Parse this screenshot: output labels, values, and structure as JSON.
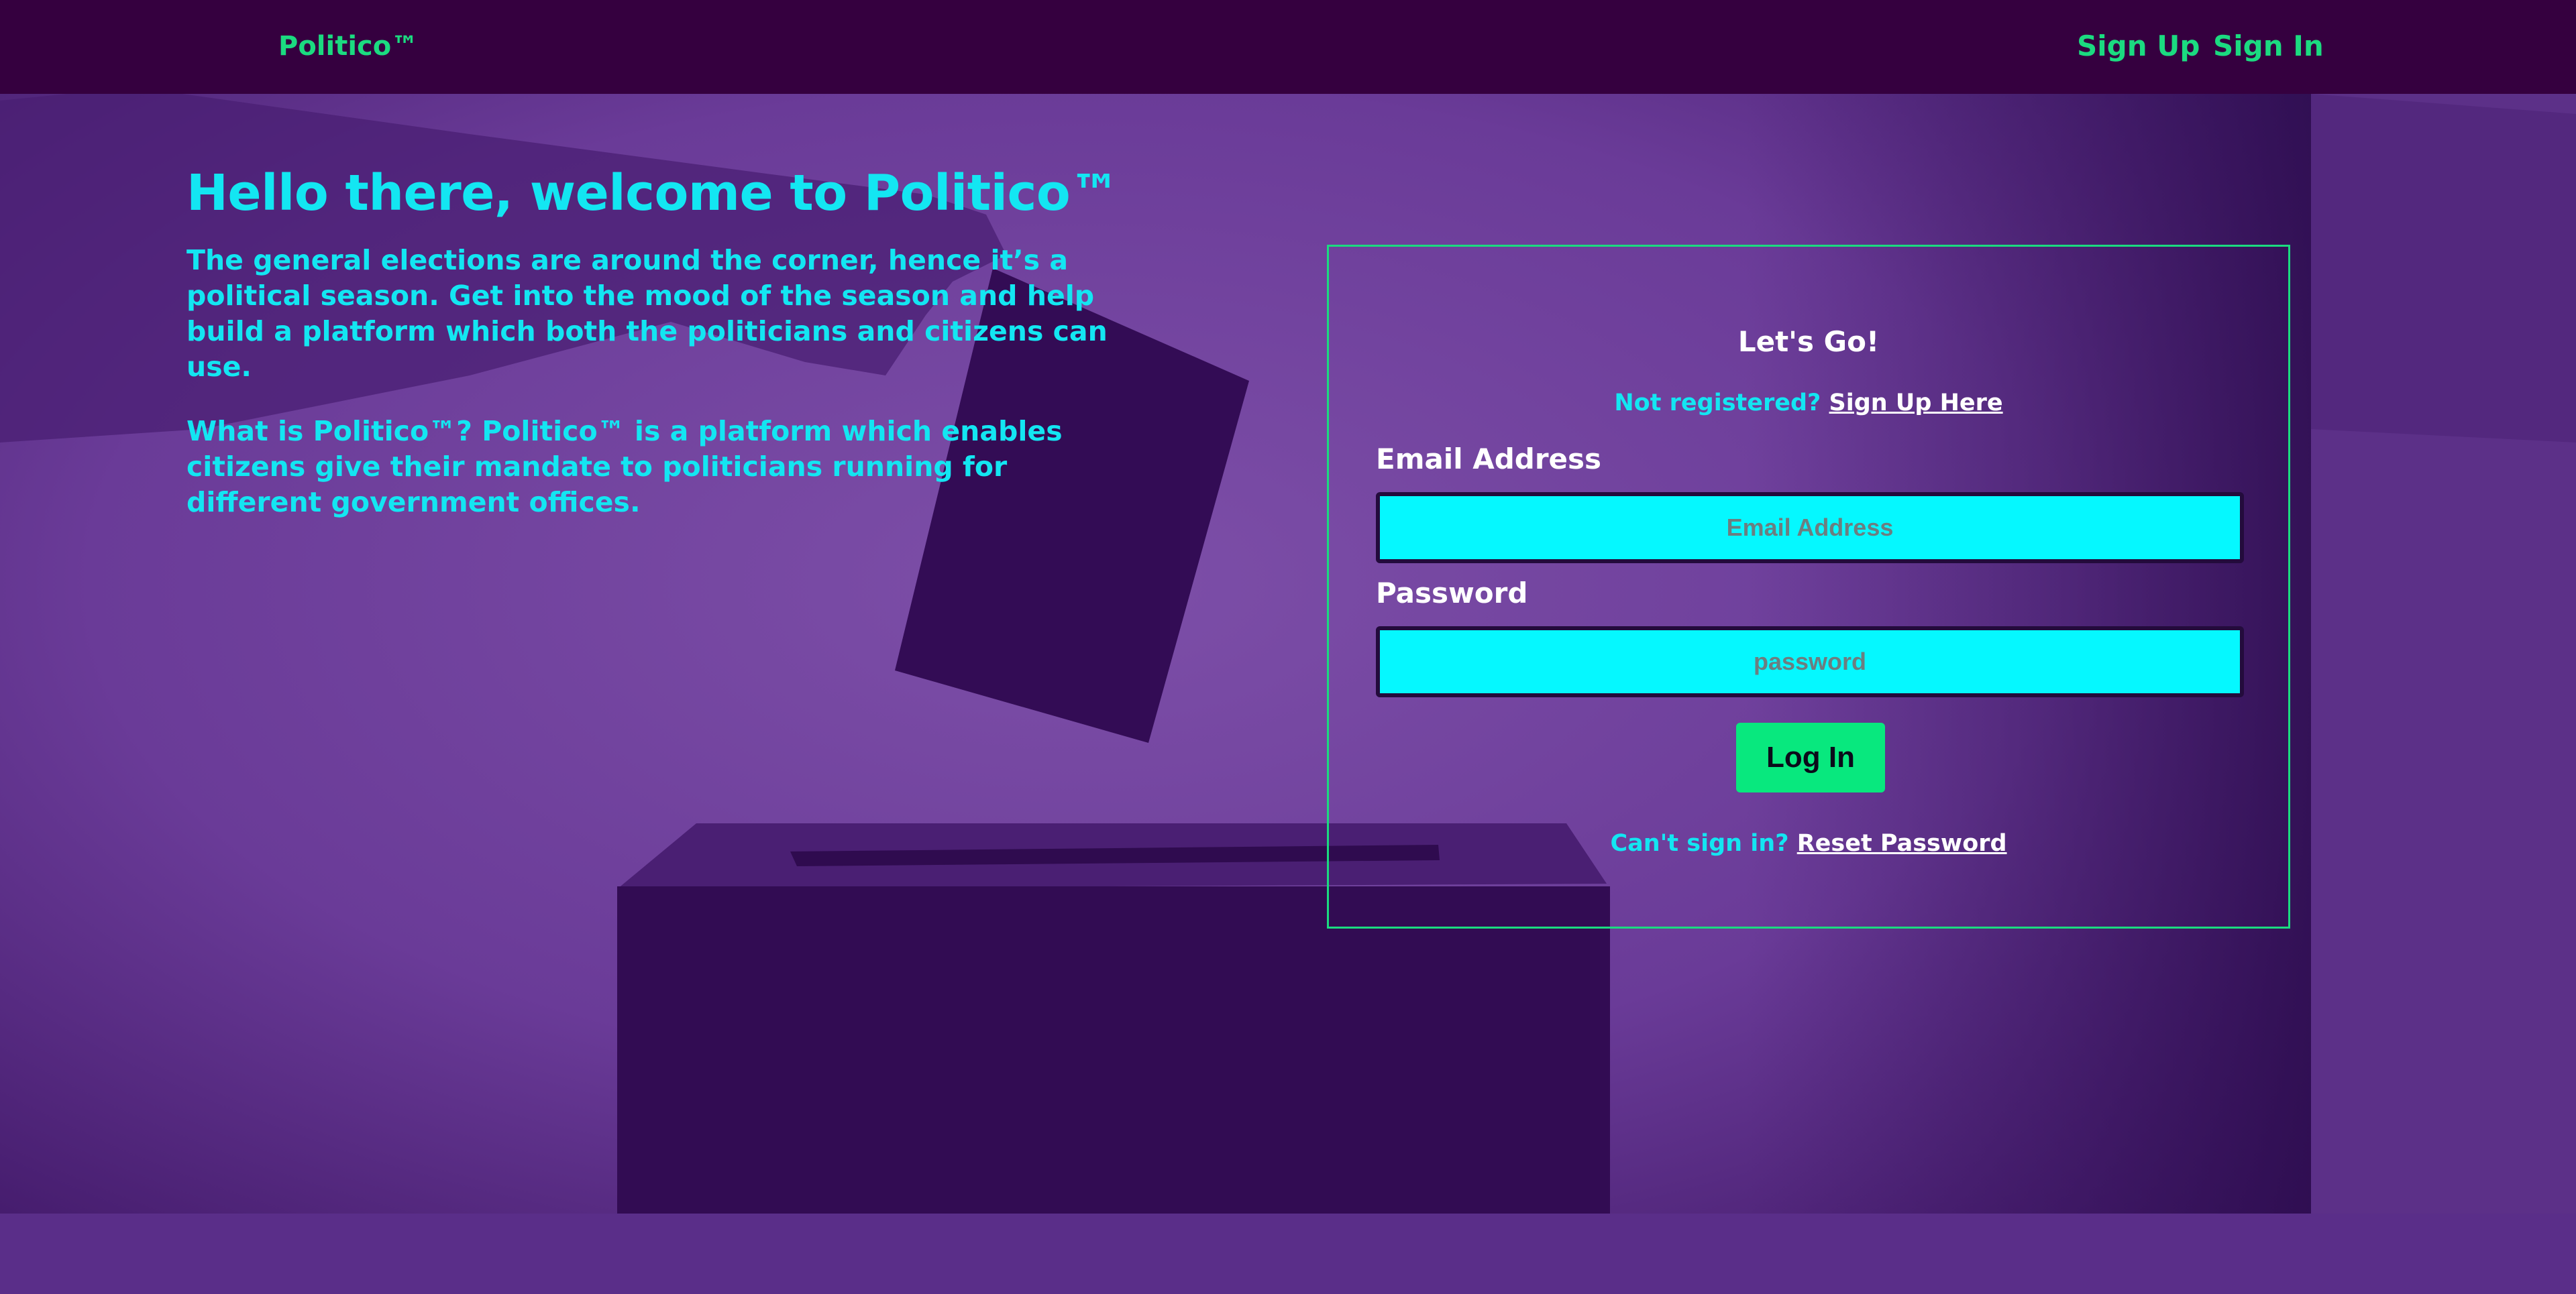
{
  "navbar": {
    "brand": "Politico™",
    "links": [
      {
        "label": "Sign Up"
      },
      {
        "label": "Sign In"
      }
    ]
  },
  "hero": {
    "heading": "Hello there, welcome to Politico™",
    "paragraph_1": "The general elections are around the corner, hence it’s a political season. Get into the mood of the season and help build a platform which both the politicians and citizens can use.",
    "paragraph_2": "What is Politico™? Politico™ is a platform which enables citizens give their mandate to politicians running for different government offices."
  },
  "login": {
    "title": "Let's Go!",
    "register_prompt": "Not registered?",
    "register_link": "Sign Up Here",
    "email_label": "Email Address",
    "email_placeholder": "Email Address",
    "email_value": "",
    "password_label": "Password",
    "password_placeholder": "password",
    "password_value": "",
    "submit_label": "Log In",
    "reset_prompt": "Can't sign in?",
    "reset_link": "Reset Password"
  },
  "colors": {
    "navbar_bg": "#35003f",
    "accent_green": "#1bdb80",
    "accent_cyan": "#13e6f2",
    "input_bg": "#05f8ff",
    "button_bg": "#08e87e",
    "page_bg": "#5a2d87"
  }
}
